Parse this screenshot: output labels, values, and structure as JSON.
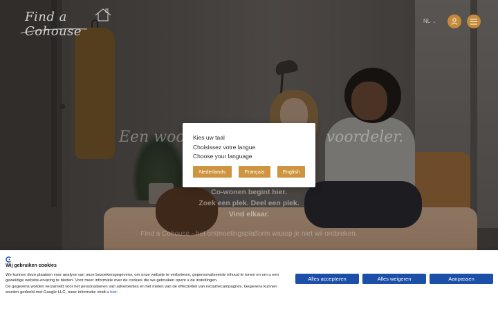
{
  "header": {
    "logo_text": "Find a Cohouse",
    "language": "NL",
    "icons": {
      "user": "user-icon",
      "menu": "hamburger-menu-icon",
      "language_caret": "chevron-down-icon"
    }
  },
  "hero": {
    "heading_start": "Een woon",
    "heading_end": "voordeler.",
    "lines": [
      "Co-wonen begint hier.",
      "Zoek een plek. Deel een plek.",
      "Vind elkaar."
    ],
    "tagline": "Find a Cohouse - het ontmoetingsplatform waaop je niet wil ontbreken."
  },
  "language_modal": {
    "lines": [
      "Kies uw taal",
      "Choisissez votre langue",
      "Choose your language"
    ],
    "buttons": {
      "nl": "Nederlands",
      "fr": "Français",
      "en": "English"
    }
  },
  "cookie_banner": {
    "title": "Wij gebruiken cookies",
    "body_1": "We kunnen deze plaatsen voor analyse van onze bezoekersgegevens, om onze website te verbeteren, gepersonaliseerde inhoud te tonen en om u een geweldige website-ervaring te bieden. Voor meer informatie over de cookies die we gebruiken opent u de instellingen.",
    "body_2": "De gegevens worden verzameld voor het personaliseren van advertenties en het meten van de effectiviteit van reclamecampagnes. Gegevens kunnen worden gedeeld met Google LLC, meer informatie vindt u",
    "link_text": "hier",
    "body_end": ".",
    "buttons": {
      "accept": "Alles accepteren",
      "refuse": "Alles weigeren",
      "customize": "Aanpassen"
    }
  },
  "colors": {
    "accent": "#cf943f",
    "cookie_button": "#1c4fa8"
  }
}
